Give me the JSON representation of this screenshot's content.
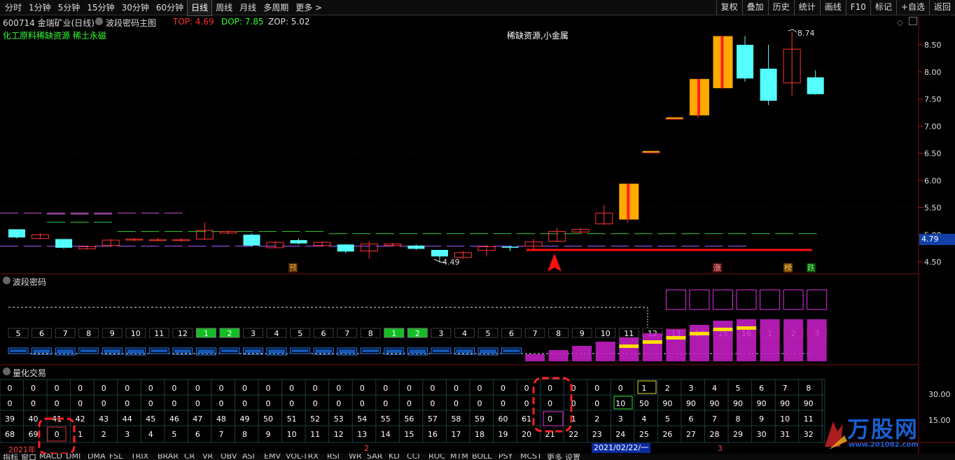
{
  "toolbar": {
    "periods": [
      "分时",
      "1分钟",
      "5分钟",
      "15分钟",
      "30分钟",
      "60分钟",
      "日线",
      "周线",
      "月线",
      "多周期",
      "更多 >"
    ],
    "active_period": "日线",
    "right_tools": [
      "复权",
      "叠加",
      "历史",
      "统计",
      "画线",
      "F10",
      "标记",
      "+自选",
      "返回"
    ]
  },
  "info": {
    "code_name": "600714 金瑞矿业(日线)",
    "indicator_name": "波段密码主图",
    "top_label": "TOP: 4.69",
    "dop_label": "DOP: 7.85",
    "zop_label": "ZOP: 5.02",
    "concepts": "化工原料稀缺资源 稀土永磁",
    "headline": "稀缺资源,小金属",
    "high_label": "8.74",
    "low_label": "4.49",
    "current_price": "4.79",
    "colors": {
      "top": "#ff3030",
      "dop": "#33ff33",
      "zop": "#dddddd",
      "concepts": "#33ff33",
      "up": "#ff3333",
      "down": "#55ffff"
    }
  },
  "price_axis": [
    "8.50",
    "8.00",
    "7.50",
    "7.00",
    "6.50",
    "6.00",
    "5.50",
    "5.00",
    "4.50"
  ],
  "markers": {
    "yu": "预",
    "zhang": "涨",
    "bang": "榜",
    "die": "跌"
  },
  "panel2": {
    "title": "波段密码",
    "counts": [
      "5",
      "6",
      "7",
      "8",
      "9",
      "10",
      "11",
      "12",
      "1",
      "2",
      "3",
      "4",
      "5",
      "6",
      "7",
      "8",
      "1",
      "2",
      "3",
      "4",
      "5",
      "6",
      "7",
      "8",
      "9",
      "10",
      "11",
      "12",
      "13",
      "14",
      "15",
      "16",
      "1",
      "2",
      "3"
    ]
  },
  "panel3": {
    "title": "量化交易",
    "axis": [
      "30.00",
      "15.00"
    ],
    "rows": [
      [
        "0",
        "0",
        "0",
        "0",
        "0",
        "0",
        "0",
        "0",
        "0",
        "0",
        "0",
        "0",
        "0",
        "0",
        "0",
        "0",
        "0",
        "0",
        "0",
        "0",
        "0",
        "0",
        "0",
        "0",
        "0",
        "0",
        "0",
        "1",
        "2",
        "3",
        "4",
        "5",
        "6",
        "7",
        "8"
      ],
      [
        "0",
        "0",
        "0",
        "0",
        "0",
        "0",
        "0",
        "0",
        "0",
        "0",
        "0",
        "0",
        "0",
        "0",
        "0",
        "0",
        "0",
        "0",
        "0",
        "0",
        "0",
        "0",
        "0",
        "0",
        "0",
        "0",
        "10",
        "50",
        "90",
        "90",
        "90",
        "90",
        "90",
        "90",
        "90"
      ],
      [
        "39",
        "40",
        "41",
        "42",
        "43",
        "44",
        "45",
        "46",
        "47",
        "48",
        "49",
        "50",
        "51",
        "52",
        "53",
        "54",
        "55",
        "56",
        "57",
        "58",
        "59",
        "60",
        "61",
        "0",
        "1",
        "2",
        "3",
        "4",
        "5",
        "6",
        "7",
        "8",
        "9",
        "10",
        "11"
      ],
      [
        "68",
        "69",
        "0",
        "1",
        "2",
        "3",
        "4",
        "5",
        "6",
        "7",
        "8",
        "9",
        "10",
        "11",
        "12",
        "13",
        "14",
        "15",
        "16",
        "17",
        "18",
        "19",
        "20",
        "21",
        "22",
        "23",
        "24",
        "25",
        "26",
        "27",
        "28",
        "29",
        "30",
        "31",
        "32"
      ]
    ]
  },
  "date_axis": {
    "year": "2021年",
    "m2": "2",
    "selected_date": "2021/02/22/一",
    "m3": "3"
  },
  "bottom_tabs": [
    "指标",
    "窗口",
    "MACD",
    "DMI",
    "DMA",
    "FSL",
    "TRIX",
    "BRAR",
    "CR",
    "VR",
    "OBV",
    "ASI",
    "EMV",
    "VOL-TRX",
    "RSI",
    "WR",
    "SAR",
    "KD",
    "CCI",
    "ROC",
    "MTM",
    "BOLL",
    "PSY",
    "MCST",
    "更多",
    "设置"
  ],
  "watermark": {
    "name": "万股网",
    "url": "www.201082.com"
  },
  "chart_data": {
    "type": "candlestick",
    "title": "600714 金瑞矿业(日线)",
    "series": [
      {
        "o": 5.1,
        "c": 4.95,
        "h": 5.1,
        "l": 4.93
      },
      {
        "o": 4.93,
        "c": 5.0,
        "h": 5.03,
        "l": 4.92
      },
      {
        "o": 4.92,
        "c": 4.76,
        "h": 4.92,
        "l": 4.74
      },
      {
        "o": 4.74,
        "c": 4.78,
        "h": 4.8,
        "l": 4.73
      },
      {
        "o": 4.8,
        "c": 4.9,
        "h": 4.92,
        "l": 4.79
      },
      {
        "o": 4.9,
        "c": 4.92,
        "h": 4.94,
        "l": 4.88
      },
      {
        "o": 4.91,
        "c": 4.91,
        "h": 4.94,
        "l": 4.88
      },
      {
        "o": 4.9,
        "c": 4.91,
        "h": 4.94,
        "l": 4.87
      },
      {
        "o": 4.92,
        "c": 5.08,
        "h": 5.23,
        "l": 4.91
      },
      {
        "o": 5.03,
        "c": 5.06,
        "h": 5.08,
        "l": 5.01
      },
      {
        "o": 5.0,
        "c": 4.8,
        "h": 5.02,
        "l": 4.78
      },
      {
        "o": 4.76,
        "c": 4.86,
        "h": 4.88,
        "l": 4.75
      },
      {
        "o": 4.9,
        "c": 4.84,
        "h": 4.93,
        "l": 4.82
      },
      {
        "o": 4.8,
        "c": 4.86,
        "h": 4.88,
        "l": 4.78
      },
      {
        "o": 4.82,
        "c": 4.69,
        "h": 4.83,
        "l": 4.66
      },
      {
        "o": 4.7,
        "c": 4.83,
        "h": 4.89,
        "l": 4.56
      },
      {
        "o": 4.8,
        "c": 4.83,
        "h": 4.85,
        "l": 4.79
      },
      {
        "o": 4.8,
        "c": 4.74,
        "h": 4.82,
        "l": 4.72
      },
      {
        "o": 4.72,
        "c": 4.6,
        "h": 4.72,
        "l": 4.49
      },
      {
        "o": 4.58,
        "c": 4.67,
        "h": 4.7,
        "l": 4.56
      },
      {
        "o": 4.71,
        "c": 4.78,
        "h": 4.81,
        "l": 4.6
      },
      {
        "o": 4.78,
        "c": 4.76,
        "h": 4.8,
        "l": 4.7
      },
      {
        "o": 4.79,
        "c": 4.87,
        "h": 4.92,
        "l": 4.72
      },
      {
        "o": 4.88,
        "c": 5.06,
        "h": 5.13,
        "l": 4.87
      },
      {
        "o": 5.05,
        "c": 5.1,
        "h": 5.12,
        "l": 5.03
      },
      {
        "o": 5.2,
        "c": 5.4,
        "h": 5.55,
        "l": 5.18
      },
      {
        "o": 5.28,
        "c": 5.94,
        "h": 5.94,
        "l": 5.22
      },
      {
        "o": 6.53,
        "c": 6.53,
        "h": 6.53,
        "l": 6.53
      },
      {
        "o": 7.15,
        "c": 7.15,
        "h": 7.15,
        "l": 7.15
      },
      {
        "o": 7.2,
        "c": 7.87,
        "h": 7.87,
        "l": 7.15
      },
      {
        "o": 7.7,
        "c": 8.66,
        "h": 8.66,
        "l": 7.69
      },
      {
        "o": 8.5,
        "c": 7.88,
        "h": 8.66,
        "l": 7.82
      },
      {
        "o": 8.06,
        "c": 7.47,
        "h": 8.5,
        "l": 7.39
      },
      {
        "o": 7.8,
        "c": 8.42,
        "h": 8.74,
        "l": 7.55
      },
      {
        "o": 7.9,
        "c": 7.59,
        "h": 8.03,
        "l": 7.58
      }
    ],
    "ylim": [
      4.3,
      8.8
    ]
  }
}
